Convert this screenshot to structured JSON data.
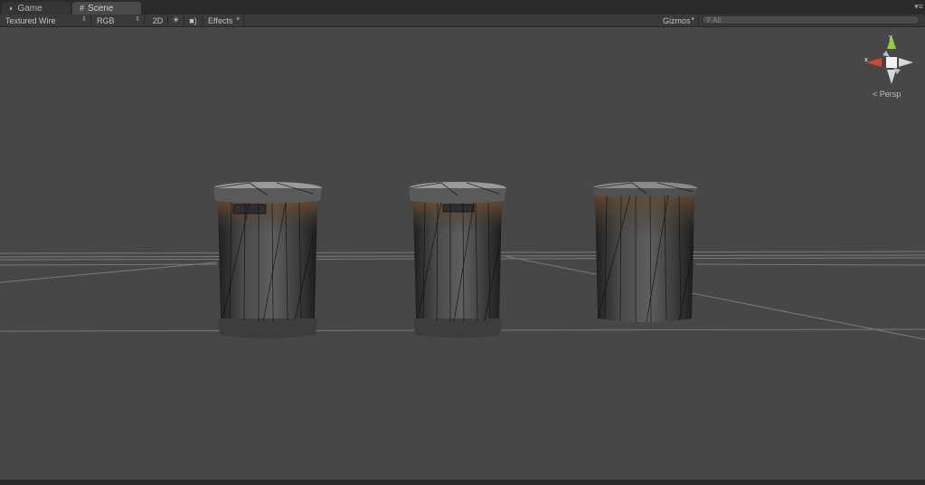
{
  "tabs": {
    "game": {
      "label": "Game",
      "icon": "game-controller-icon"
    },
    "scene": {
      "label": "Scene",
      "icon": "scene-grid-icon"
    }
  },
  "tab_menu_icon": "tab-menu-icon",
  "toolbar": {
    "draw_mode": "Textured Wire",
    "render_mode": "RGB",
    "mode_2d": "2D",
    "lighting_icon": "sun-icon",
    "audio_icon": "speaker-icon",
    "effects": "Effects",
    "gizmos": "Gizmos",
    "search_placeholder": "All"
  },
  "gizmo": {
    "x_axis": "x",
    "y_axis": "y",
    "projection": "< Persp",
    "colors": {
      "x": "#d94225",
      "y": "#8fcf3a",
      "z": "#ffffff"
    }
  },
  "scene": {
    "background": "#474747",
    "objects": [
      "trash-can",
      "trash-can",
      "trash-can"
    ]
  }
}
